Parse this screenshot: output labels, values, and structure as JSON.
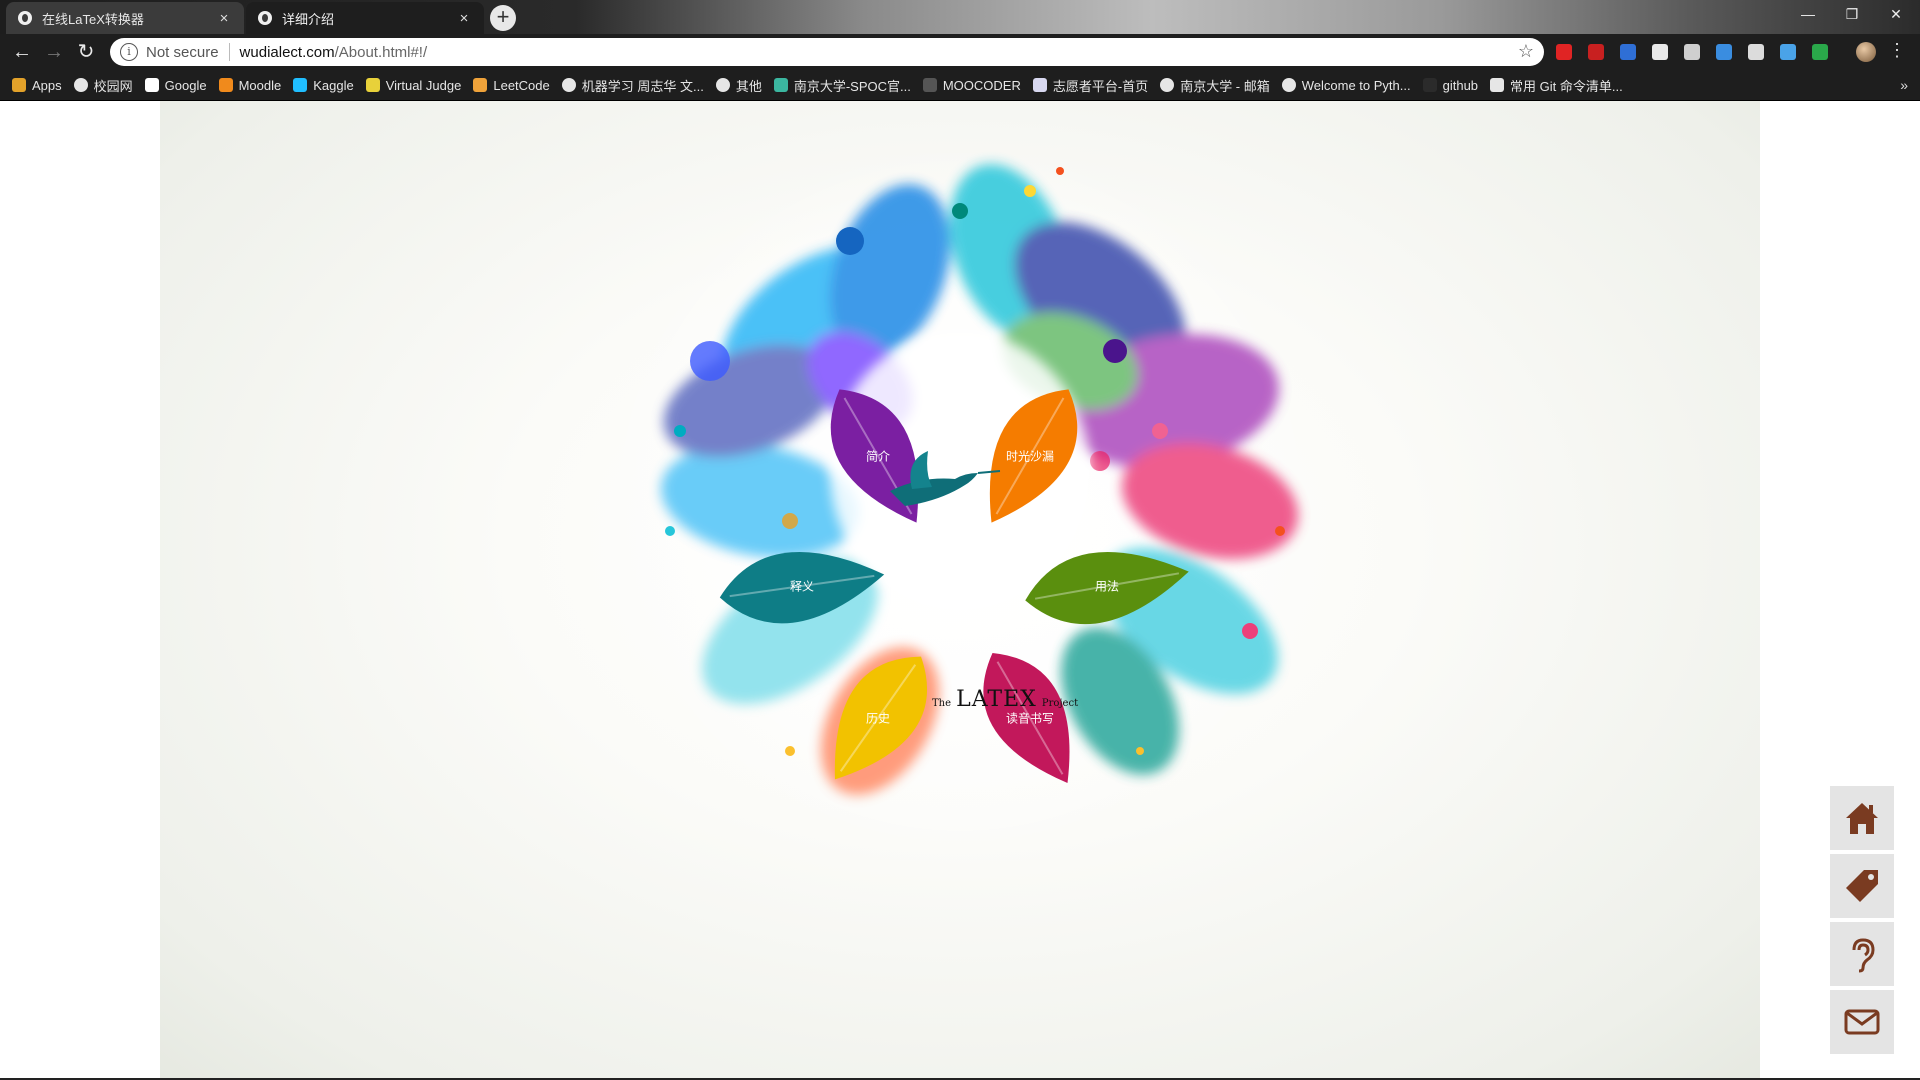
{
  "browser": {
    "tabs": [
      {
        "title": "在线LaTeX转换器",
        "close": "×"
      },
      {
        "title": "详细介绍",
        "close": "×"
      }
    ],
    "new_tab": "+",
    "window_controls": {
      "minimize": "—",
      "restore": "❐",
      "close": "✕"
    },
    "nav": {
      "back": "←",
      "forward": "→",
      "reload": "↻"
    },
    "address": {
      "security": "Not secure",
      "host": "wudialect.com",
      "path": "/About.html#!/",
      "info": "i",
      "star": "☆"
    },
    "menu": "⋮",
    "extension_colors": [
      "#e02424",
      "#c82020",
      "#2f6fd6",
      "#e9e9e9",
      "#cfcfcf",
      "#3a8de0",
      "#dcdcdc",
      "#4aa3e8",
      "#2aa84a"
    ],
    "bookmarks": [
      {
        "label": "Apps",
        "icon": "apps-grid-icon",
        "color": "#e3a22a"
      },
      {
        "label": "校园网",
        "icon": "globe-icon",
        "color": "#e6e6e6"
      },
      {
        "label": "Google",
        "icon": "google-icon",
        "color": "#ffffff"
      },
      {
        "label": "Moodle",
        "icon": "moodle-icon",
        "color": "#f08a1c"
      },
      {
        "label": "Kaggle",
        "icon": "kaggle-icon",
        "color": "#20beff"
      },
      {
        "label": "Virtual Judge",
        "icon": "vjudge-icon",
        "color": "#e8d13a"
      },
      {
        "label": "LeetCode",
        "icon": "leetcode-icon",
        "color": "#f0a33a"
      },
      {
        "label": "机器学习 周志华 文...",
        "icon": "globe-icon",
        "color": "#e6e6e6"
      },
      {
        "label": "其他",
        "icon": "globe-icon",
        "color": "#e6e6e6"
      },
      {
        "label": "南京大学-SPOC官...",
        "icon": "book-icon",
        "color": "#3bb7a0"
      },
      {
        "label": "MOOCODER",
        "icon": "moocoder-icon",
        "color": "#555555"
      },
      {
        "label": "志愿者平台-首页",
        "icon": "volunteer-icon",
        "color": "#d8d8f0"
      },
      {
        "label": "南京大学 - 邮箱",
        "icon": "globe-icon",
        "color": "#e6e6e6"
      },
      {
        "label": "Welcome to Pyth...",
        "icon": "globe-icon",
        "color": "#e6e6e6"
      },
      {
        "label": "github",
        "icon": "github-icon",
        "color": "#2b2b2b"
      },
      {
        "label": "常用 Git 命令清单...",
        "icon": "doc-icon",
        "color": "#e6e6e6"
      }
    ],
    "bookmarks_more": "»"
  },
  "menu_leaves": [
    {
      "label": "简介",
      "color": "#7b1fa2"
    },
    {
      "label": "时光沙漏",
      "color": "#f57c00"
    },
    {
      "label": "释义",
      "color": "#0e7d86"
    },
    {
      "label": "用法",
      "color": "#5a8f0e"
    },
    {
      "label": "历史",
      "color": "#f2c200"
    },
    {
      "label": "读音书写",
      "color": "#c2185b"
    }
  ],
  "logo": {
    "the": "The",
    "name": "LATEX",
    "project": "Project"
  },
  "dock": [
    {
      "icon": "home-icon",
      "color": "#7a3b21"
    },
    {
      "icon": "tag-icon",
      "color": "#7a3b21"
    },
    {
      "icon": "ear-icon",
      "color": "#7a3b21"
    },
    {
      "icon": "mail-icon",
      "color": "#7a3b21"
    }
  ]
}
